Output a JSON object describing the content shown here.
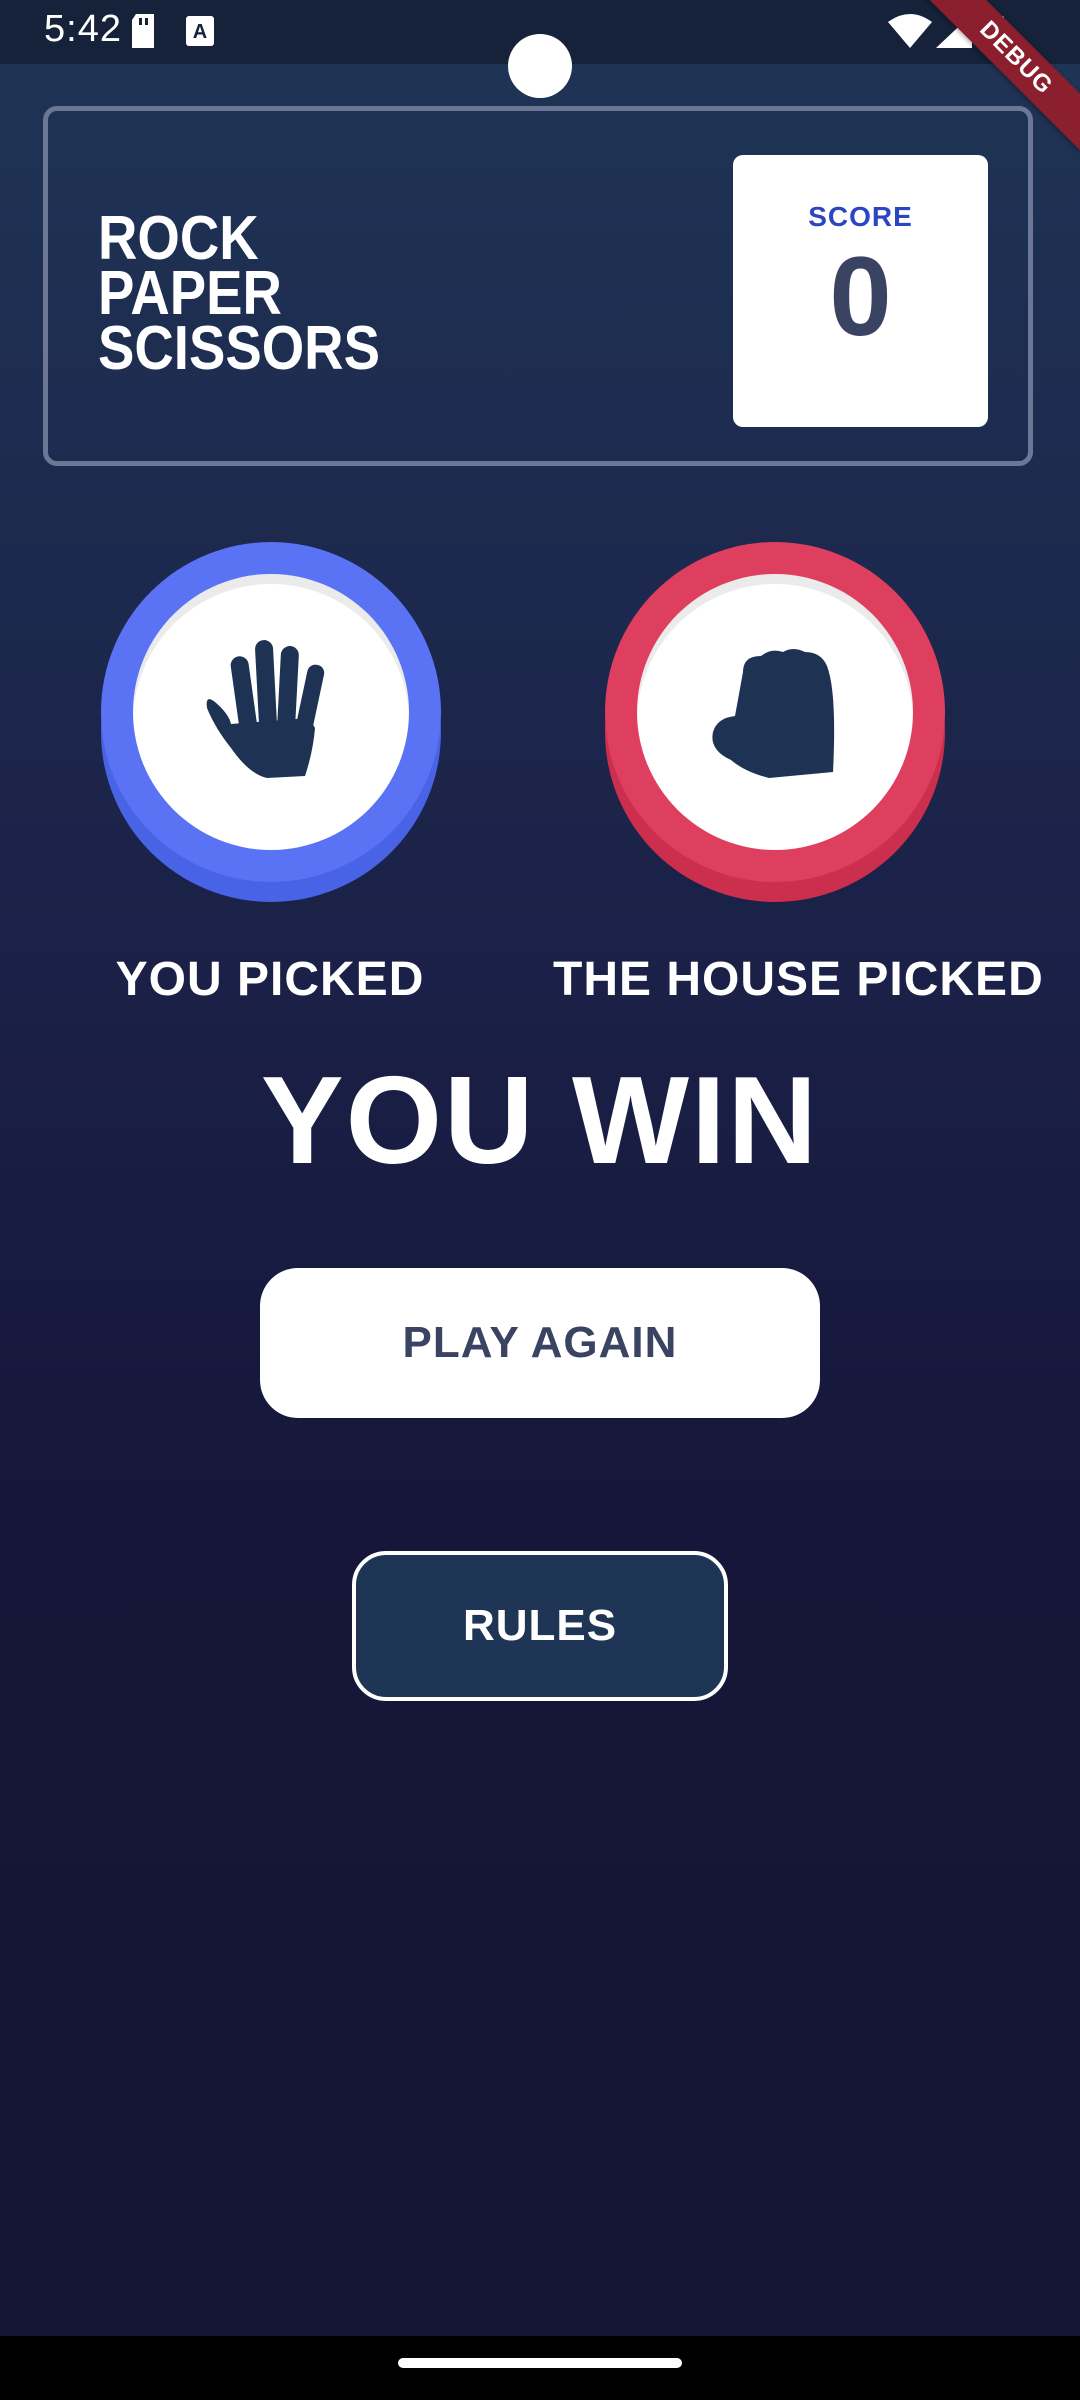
{
  "status_bar": {
    "time": "5:42",
    "debug_label": "DEBUG"
  },
  "header": {
    "title_lines": [
      "ROCK",
      "PAPER",
      "SCISSORS"
    ],
    "score_label": "SCORE",
    "score_value": "0"
  },
  "game": {
    "player_pick": {
      "label": "YOU PICKED",
      "choice": "paper",
      "icon": "hand-paper-icon",
      "color": "#5a73f5"
    },
    "house_pick": {
      "label": "THE HOUSE PICKED",
      "choice": "rock",
      "icon": "hand-rock-icon",
      "color": "#df3f5f"
    },
    "result": "YOU WIN"
  },
  "buttons": {
    "play_again": "PLAY AGAIN",
    "rules": "RULES"
  },
  "colors": {
    "background_top": "#1f3556",
    "background_bottom": "#141535",
    "score_text": "#3b4363",
    "score_label": "#2a46c0"
  }
}
